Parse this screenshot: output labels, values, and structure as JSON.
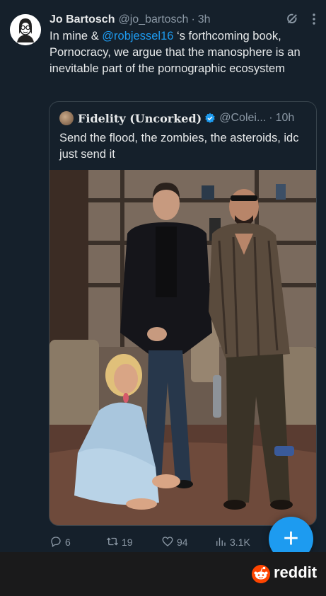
{
  "tweet": {
    "display_name": "Jo Bartosch",
    "handle": "@jo_bartosch",
    "separator": "·",
    "time": "3h",
    "text_before": "In mine & ",
    "mention": "@robjessel16",
    "text_after": " ‘s forthcoming book, Pornocracy, we argue that the manosphere is an inevitable part of the pornographic ecosystem"
  },
  "quote": {
    "display_name": "Fidelity (Uncorked)",
    "handle": "@Colei...",
    "separator": "·",
    "time": "10h",
    "text": "Send the flood, the zombies, the asteroids, idc just send it"
  },
  "actions": {
    "replies": "6",
    "reposts": "19",
    "likes": "94",
    "views": "3.1K"
  },
  "fab": {
    "label": "+"
  },
  "footer": {
    "brand": "reddit"
  },
  "icons": {
    "grok": "grok-icon",
    "more": "more-icon",
    "verified": "verified-badge-icon",
    "reply": "reply-icon",
    "repost": "repost-icon",
    "like": "like-icon",
    "views": "views-icon",
    "reddit": "reddit-logo-icon"
  },
  "colors": {
    "background": "#15202b",
    "text": "#e7e9ea",
    "secondary_text": "#8b98a5",
    "accent": "#1d9bf0",
    "reddit_orange": "#ff4500"
  }
}
